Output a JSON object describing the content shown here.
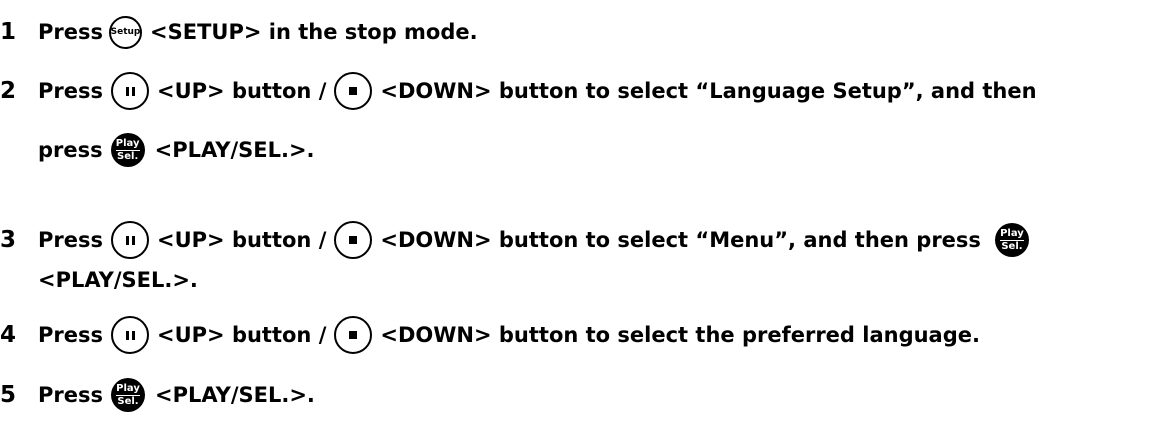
{
  "steps": [
    {
      "num": "1",
      "press": "Press",
      "setup_label": "Setup",
      "after_setup": "<SETUP> in the stop mode."
    },
    {
      "num": "2",
      "press": "Press",
      "up_text": "<UP> button /",
      "down_text": "<DOWN> button to select “Language Setup”, and then",
      "cont_press": "press",
      "play_top": "Play",
      "play_bottom": "Sel.",
      "play_text": "<PLAY/SEL.>."
    },
    {
      "num": "3",
      "press": "Press",
      "up_text": "<UP> button /",
      "down_text": "<DOWN> button to select “Menu”, and then press",
      "play_top": "Play",
      "play_bottom": "Sel.",
      "play_text": "<PLAY/SEL.>."
    },
    {
      "num": "4",
      "press": "Press",
      "up_text": "<UP> button /",
      "down_text": "<DOWN> button to select the preferred language."
    },
    {
      "num": "5",
      "press": "Press",
      "play_top": "Play",
      "play_bottom": "Sel.",
      "play_text": "<PLAY/SEL.>."
    }
  ],
  "icons": {
    "up": "pause-icon",
    "down": "stop-icon",
    "setup": "setup-button-icon",
    "play": "play-sel-button-icon"
  }
}
